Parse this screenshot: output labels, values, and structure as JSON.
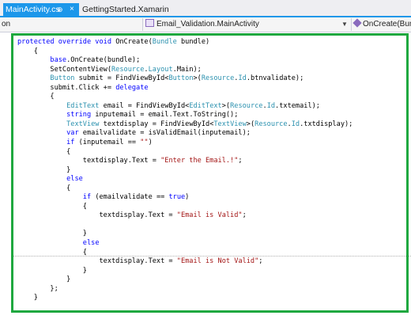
{
  "tabs": [
    {
      "label": "MainActivity.cs",
      "pin": "⊕",
      "close": "×",
      "active": true
    },
    {
      "label": "GettingStarted.Xamarin",
      "active": false
    }
  ],
  "navbar": {
    "left": "on",
    "class_dropdown": "Email_Validation.MainActivity",
    "method_dropdown": "OnCreate(Bun"
  },
  "colors": {
    "accent": "#1c97ea",
    "highlight": "#1fa83f",
    "keyword": "#0000ff",
    "type": "#2b91af",
    "string": "#a31515"
  },
  "code_lines": [
    [
      [
        "kw",
        "protected override void "
      ],
      [
        "pl",
        "OnCreate("
      ],
      [
        "ty",
        "Bundle"
      ],
      [
        "pl",
        " bundle)"
      ]
    ],
    [
      [
        "pl",
        "    {"
      ]
    ],
    [
      [
        "pl",
        "        "
      ],
      [
        "kw",
        "base"
      ],
      [
        "pl",
        ".OnCreate(bundle);"
      ]
    ],
    [
      [
        "pl",
        "        SetContentView("
      ],
      [
        "ty",
        "Resource"
      ],
      [
        "pl",
        "."
      ],
      [
        "ty",
        "Layout"
      ],
      [
        "pl",
        ".Main);"
      ]
    ],
    [
      [
        "pl",
        "        "
      ],
      [
        "ty",
        "Button"
      ],
      [
        "pl",
        " submit = FindViewById<"
      ],
      [
        "ty",
        "Button"
      ],
      [
        "pl",
        ">("
      ],
      [
        "ty",
        "Resource"
      ],
      [
        "pl",
        "."
      ],
      [
        "ty",
        "Id"
      ],
      [
        "pl",
        ".btnvalidate);"
      ]
    ],
    [
      [
        "pl",
        "        submit.Click += "
      ],
      [
        "kw",
        "delegate"
      ]
    ],
    [
      [
        "pl",
        "        {"
      ]
    ],
    [
      [
        "pl",
        "            "
      ],
      [
        "ty",
        "EditText"
      ],
      [
        "pl",
        " email = FindViewById<"
      ],
      [
        "ty",
        "EditText"
      ],
      [
        "pl",
        ">("
      ],
      [
        "ty",
        "Resource"
      ],
      [
        "pl",
        "."
      ],
      [
        "ty",
        "Id"
      ],
      [
        "pl",
        ".txtemail);"
      ]
    ],
    [
      [
        "pl",
        "            "
      ],
      [
        "kw",
        "string"
      ],
      [
        "pl",
        " inputemail = email.Text.ToString();"
      ]
    ],
    [
      [
        "pl",
        "            "
      ],
      [
        "ty",
        "TextView"
      ],
      [
        "pl",
        " textdisplay = FindViewById<"
      ],
      [
        "ty",
        "TextView"
      ],
      [
        "pl",
        ">("
      ],
      [
        "ty",
        "Resource"
      ],
      [
        "pl",
        "."
      ],
      [
        "ty",
        "Id"
      ],
      [
        "pl",
        ".txtdisplay);"
      ]
    ],
    [
      [
        "pl",
        "            "
      ],
      [
        "kw",
        "var"
      ],
      [
        "pl",
        " emailvalidate = isValidEmail(inputemail);"
      ]
    ],
    [
      [
        "pl",
        "            "
      ],
      [
        "kw",
        "if"
      ],
      [
        "pl",
        " (inputemail == "
      ],
      [
        "st",
        "\"\""
      ],
      [
        "pl",
        ")"
      ]
    ],
    [
      [
        "pl",
        "            {"
      ]
    ],
    [
      [
        "pl",
        "                textdisplay.Text = "
      ],
      [
        "st",
        "\"Enter the Email.!\""
      ],
      [
        "pl",
        ";"
      ]
    ],
    [
      [
        "pl",
        "            }"
      ]
    ],
    [
      [
        "pl",
        "            "
      ],
      [
        "kw",
        "else"
      ]
    ],
    [
      [
        "pl",
        "            {"
      ]
    ],
    [
      [
        "pl",
        "                "
      ],
      [
        "kw",
        "if"
      ],
      [
        "pl",
        " (emailvalidate == "
      ],
      [
        "kw",
        "true"
      ],
      [
        "pl",
        ")"
      ]
    ],
    [
      [
        "pl",
        "                {"
      ]
    ],
    [
      [
        "pl",
        "                    textdisplay.Text = "
      ],
      [
        "st",
        "\"Email is Valid\""
      ],
      [
        "pl",
        ";"
      ]
    ],
    [
      [
        "pl",
        ""
      ]
    ],
    [
      [
        "pl",
        "                }"
      ]
    ],
    [
      [
        "pl",
        "                "
      ],
      [
        "kw",
        "else"
      ]
    ],
    [
      [
        "pl",
        "                {"
      ]
    ],
    [
      [
        "pl",
        "                    textdisplay.Text = "
      ],
      [
        "st",
        "\"Email is Not Valid\""
      ],
      [
        "pl",
        ";"
      ]
    ],
    [
      [
        "pl",
        "                }"
      ]
    ],
    [
      [
        "pl",
        "            }"
      ]
    ],
    [
      [
        "pl",
        "        };"
      ]
    ],
    [
      [
        "pl",
        "    }"
      ]
    ]
  ]
}
